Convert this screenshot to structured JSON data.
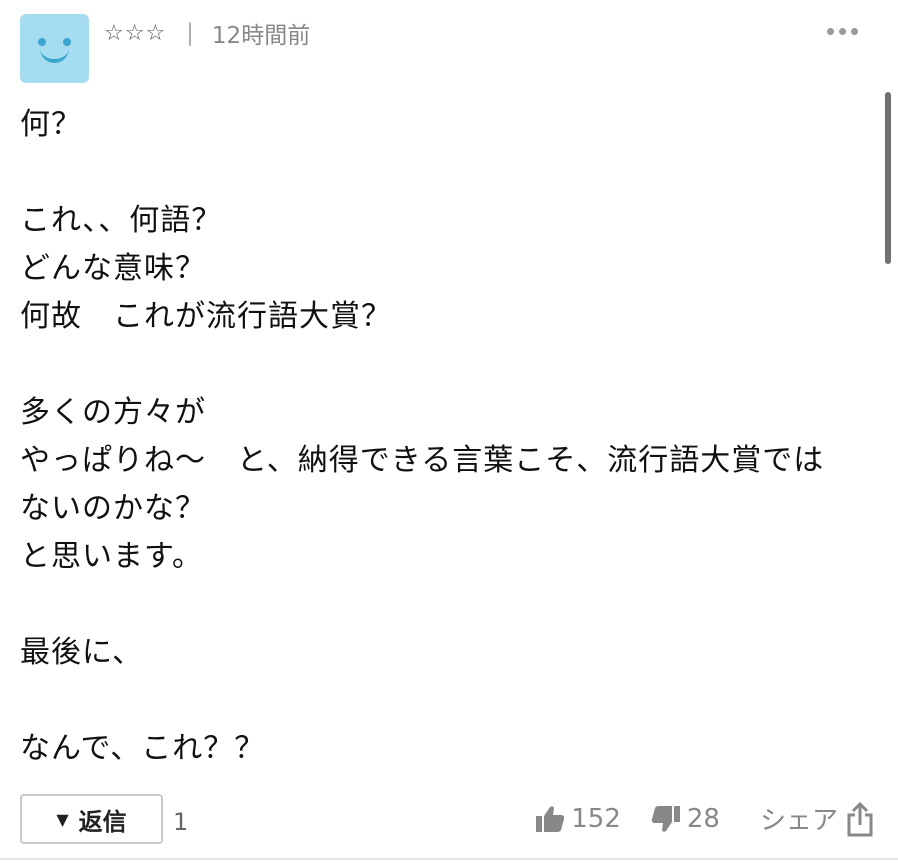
{
  "comment": {
    "rating_stars": "☆☆☆",
    "separator": "|",
    "time": "12時間前",
    "body": "何？\n\nこれ、、何語？\nどんな意味？\n何故　これが流行語大賞？\n\n多くの方々が\nやっぱりね〜　と、納得できる言葉こそ、流行語大賞では\nないのかな？\nと思います。\n\n最後に、\n\nなんで、これ？？",
    "reply_label": "返信",
    "reply_triangle": "▼",
    "reply_count": "1",
    "likes": "152",
    "dislikes": "28",
    "share_label": "シェア"
  },
  "colors": {
    "avatar_bg": "#a6dcf0",
    "avatar_face": "#3aa6cf",
    "icon_gray": "#888888"
  },
  "icons": {
    "avatar": "smiley-face-icon",
    "more": "more-dots-icon",
    "like": "thumbs-up-icon",
    "dislike": "thumbs-down-icon",
    "share": "share-icon"
  }
}
